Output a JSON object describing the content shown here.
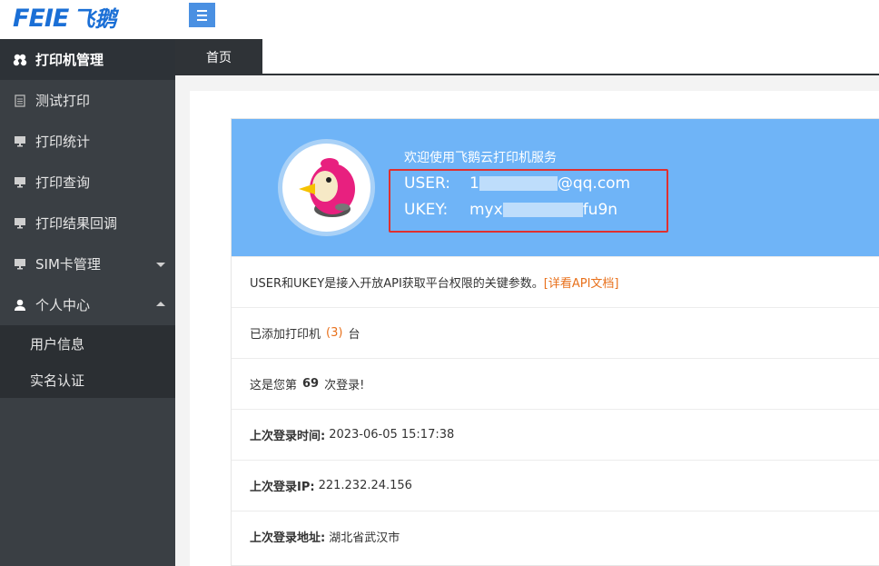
{
  "brand": {
    "logo_latin": "FEIE",
    "logo_cn": "飞鹅"
  },
  "sidebar": {
    "items": [
      {
        "label": "打印机管理",
        "icon": "cubes-icon",
        "active": true
      },
      {
        "label": "测试打印",
        "icon": "document-icon"
      },
      {
        "label": "打印统计",
        "icon": "monitor-icon"
      },
      {
        "label": "打印查询",
        "icon": "monitor-icon"
      },
      {
        "label": "打印结果回调",
        "icon": "monitor-icon"
      },
      {
        "label": "SIM卡管理",
        "icon": "monitor-icon",
        "caret": "down"
      },
      {
        "label": "个人中心",
        "icon": "user-icon",
        "caret": "up"
      }
    ],
    "sub_items": [
      "用户信息",
      "实名认证"
    ]
  },
  "tabs": [
    {
      "label": "首页"
    }
  ],
  "banner": {
    "welcome": "欢迎使用飞鹅云打印机服务",
    "user_label": "USER:",
    "user_prefix": "1",
    "user_suffix": "@qq.com",
    "ukey_label": "UKEY:",
    "ukey_prefix": "myx",
    "ukey_suffix": "fu9n",
    "highlight_color": "#e0302f",
    "banner_color": "#6fb4f7"
  },
  "info": {
    "api_note": "USER和UKEY是接入开放API获取平台权限的关键参数。",
    "api_link": "[详看API文档]",
    "printers_prefix": "已添加打印机",
    "printers_count": "(3)",
    "printers_suffix": "台",
    "login_prefix": "这是您第",
    "login_count": "69",
    "login_suffix": "次登录!",
    "last_time_label": "上次登录时间:",
    "last_time_value": "2023-06-05 15:17:38",
    "last_ip_label": "上次登录IP:",
    "last_ip_value": "221.232.24.156",
    "last_addr_label": "上次登录地址:",
    "last_addr_value": "湖北省武汉市"
  }
}
